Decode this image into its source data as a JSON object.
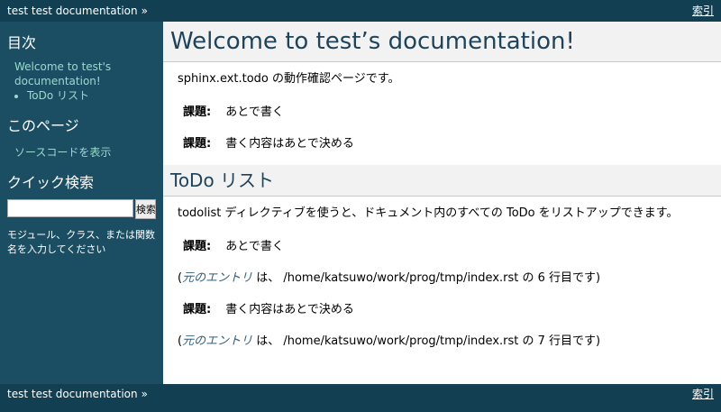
{
  "relbar": {
    "title": "test test documentation",
    "chevron": "»",
    "index_link": "索引"
  },
  "sidebar": {
    "toc_heading": "目次",
    "toc_root": "Welcome to test's documentation!",
    "toc_sub": "ToDo リスト",
    "this_page_heading": "このページ",
    "show_source": "ソースコードを表示",
    "quick_search_heading": "クイック検索",
    "search_value": "",
    "search_button": "検索",
    "search_hint": "モジュール、クラス、または関数名を入力してください"
  },
  "main": {
    "title": "Welcome to test’s documentation!",
    "intro": "sphinx.ext.todo の動作確認ページです。",
    "todos_top": [
      {
        "label": "課題:",
        "text": "あとで書く"
      },
      {
        "label": "課題:",
        "text": "書く内容はあとで決める"
      }
    ],
    "section_title": "ToDo リスト",
    "section_intro": "todolist ディレクティブを使うと、ドキュメント内のすべての ToDo をリストアップできます。",
    "todolist": [
      {
        "label": "課題:",
        "text": "あとで書く",
        "orig_open": "(",
        "orig_link": "元のエントリ",
        "orig_rest": " は、 /home/katsuwo/work/prog/tmp/index.rst の 6 行目です)"
      },
      {
        "label": "課題:",
        "text": "書く内容はあとで決める",
        "orig_open": "(",
        "orig_link": "元のエントリ",
        "orig_rest": " は、 /home/katsuwo/work/prog/tmp/index.rst の 7 行目です)"
      }
    ]
  }
}
